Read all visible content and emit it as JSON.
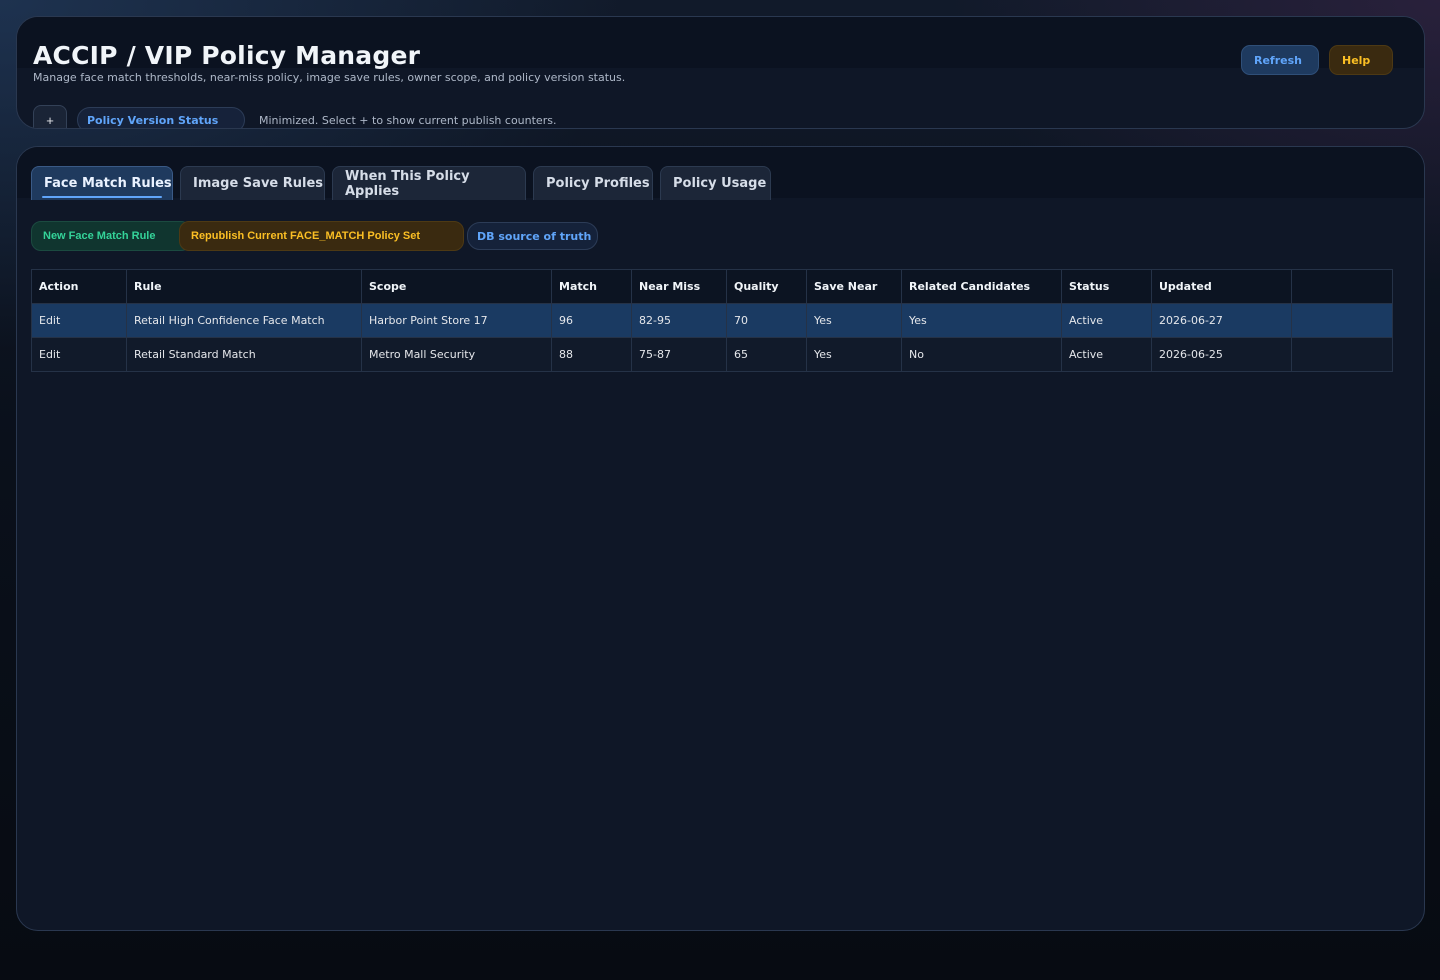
{
  "header": {
    "title": "ACCIP / VIP Policy Manager",
    "subtitle": "Manage face match thresholds, near-miss policy, image save rules, owner scope, and policy version status.",
    "refresh_label": "Refresh",
    "help_label": "Help",
    "expand_label": "+",
    "status_pill_label": "Policy Version Status",
    "status_note": "Minimized. Select + to show current publish counters."
  },
  "tabs": [
    {
      "label": "Face Match Rules",
      "active": true
    },
    {
      "label": "Image Save Rules",
      "active": false
    },
    {
      "label": "When This Policy Applies",
      "active": false
    },
    {
      "label": "Policy Profiles",
      "active": false
    },
    {
      "label": "Policy Usage",
      "active": false
    }
  ],
  "toolbar": {
    "new_rule_label": "New Face Match Rule",
    "republish_label": "Republish Current FACE_MATCH Policy Set",
    "db_badge_label": "DB source of truth"
  },
  "table": {
    "columns": [
      "Action",
      "Rule",
      "Scope",
      "Match",
      "Near Miss",
      "Quality",
      "Save Near",
      "Related Candidates",
      "Status",
      "Updated",
      ""
    ],
    "rows": [
      {
        "action": "Edit",
        "rule": "Retail High Confidence Face Match",
        "scope": "Harbor Point Store 17",
        "match": "96",
        "near_miss": "82-95",
        "quality": "70",
        "save_near": "Yes",
        "related": "Yes",
        "status": "Active",
        "updated": "2026-06-27",
        "extra": "",
        "selected": true
      },
      {
        "action": "Edit",
        "rule": "Retail Standard Match",
        "scope": "Metro Mall Security",
        "match": "88",
        "near_miss": "75-87",
        "quality": "65",
        "save_near": "Yes",
        "related": "No",
        "status": "Active",
        "updated": "2026-06-25",
        "extra": "",
        "selected": false
      }
    ]
  },
  "colors": {
    "accent_blue": "#60a5fa",
    "accent_amber": "#fbbf24",
    "accent_green": "#34d399",
    "selected_row": "#1a3a62"
  }
}
